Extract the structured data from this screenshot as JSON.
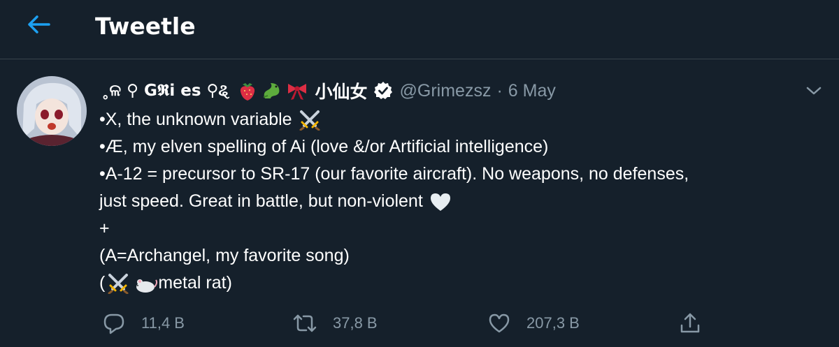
{
  "header": {
    "title": "Tweetle",
    "back_icon": "arrow-left-icon",
    "accent_color": "#1da1f2"
  },
  "tweet": {
    "author_name": "˳ଳ ⚲ G𝕽i  es ⚲ୡ",
    "author_name_emojis": [
      "strawberry-icon",
      "dragon-icon",
      "ribbon-icon"
    ],
    "author_suffix": "小仙女",
    "verified": true,
    "handle": "@Grimezsz",
    "separator": "·",
    "date": "6 May",
    "lines": [
      "•X, the unknown variable",
      "•Æ, my elven spelling of Ai (love &/or Artificial intelligence)",
      "•A-12 = precursor to SR-17 (our favorite aircraft).  No weapons, no defenses,",
      "just speed.  Great in battle, but non-violent",
      "+",
      "(A=Archangel, my favorite song)",
      "(",
      " metal rat)"
    ],
    "line_icons": {
      "line1": "crossed-swords-icon",
      "line4": "white-heart-icon",
      "line8": [
        "crossed-swords-icon",
        "rat-icon"
      ]
    }
  },
  "actions": {
    "reply_count": "11,4 В",
    "retweet_count": "37,8 В",
    "like_count": "207,3 В",
    "share_icon": "share-icon"
  },
  "colors": {
    "background": "#15202b",
    "text": "#ffffff",
    "muted": "#8899a6",
    "divider": "#38444d"
  }
}
